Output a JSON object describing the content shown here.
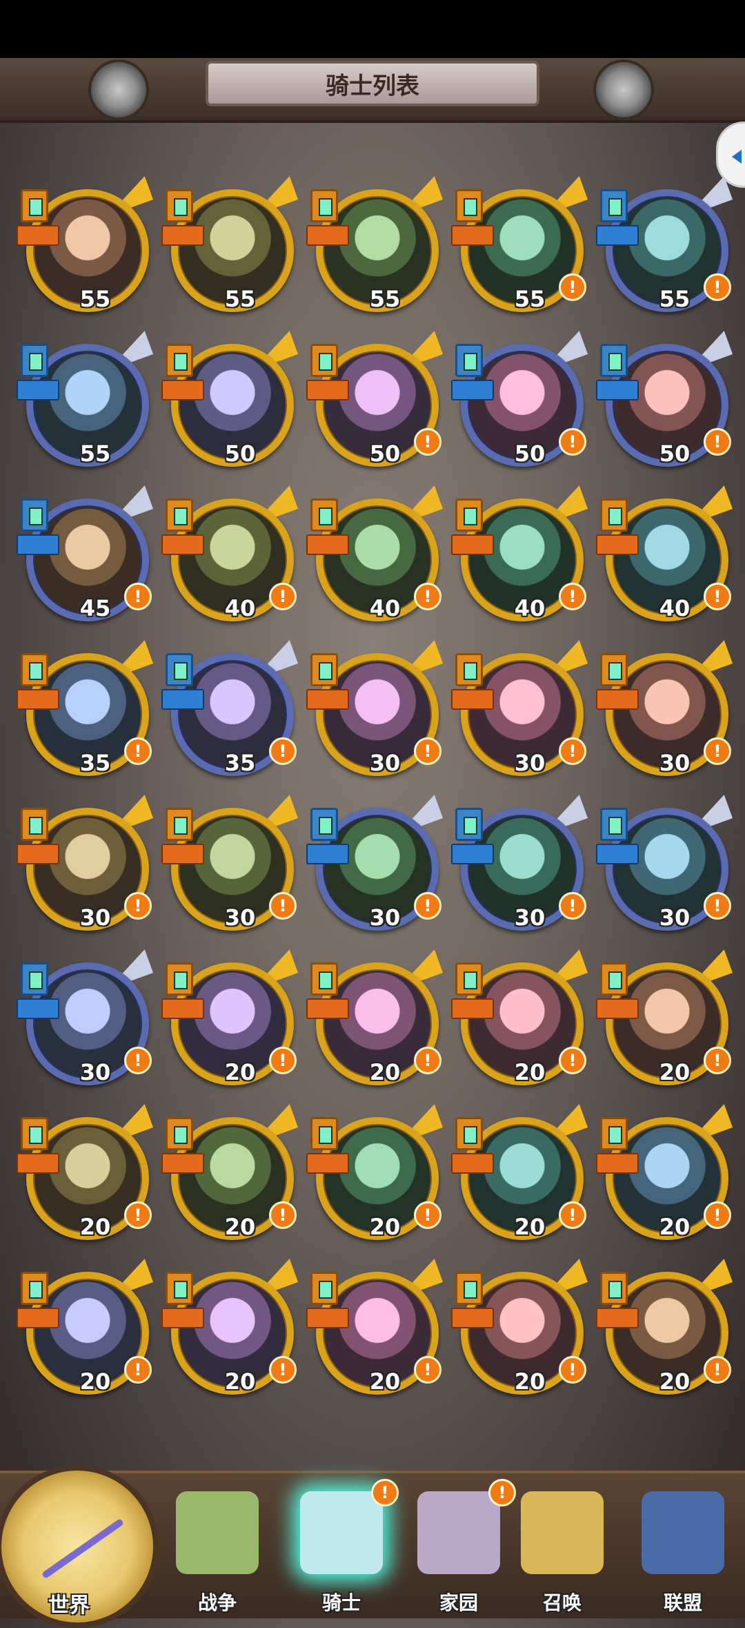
{
  "header": {
    "title": "骑士列表"
  },
  "colors": {
    "gold_ring": "#d9a31c",
    "blue_ring": "#5a6bb0",
    "alert": "#f07a14",
    "active_glow": "#52ffe8"
  },
  "knights": [
    {
      "level": "55",
      "frame": "gold",
      "alert": false
    },
    {
      "level": "55",
      "frame": "gold",
      "alert": false
    },
    {
      "level": "55",
      "frame": "gold",
      "alert": false
    },
    {
      "level": "55",
      "frame": "gold",
      "alert": true
    },
    {
      "level": "55",
      "frame": "blue",
      "alert": true
    },
    {
      "level": "55",
      "frame": "blue",
      "alert": false
    },
    {
      "level": "50",
      "frame": "gold",
      "alert": false
    },
    {
      "level": "50",
      "frame": "gold",
      "alert": true
    },
    {
      "level": "50",
      "frame": "blue",
      "alert": true
    },
    {
      "level": "50",
      "frame": "blue",
      "alert": true
    },
    {
      "level": "45",
      "frame": "blue",
      "alert": true
    },
    {
      "level": "40",
      "frame": "gold",
      "alert": true
    },
    {
      "level": "40",
      "frame": "gold",
      "alert": true
    },
    {
      "level": "40",
      "frame": "gold",
      "alert": true
    },
    {
      "level": "40",
      "frame": "gold",
      "alert": true
    },
    {
      "level": "35",
      "frame": "gold",
      "alert": true
    },
    {
      "level": "35",
      "frame": "blue",
      "alert": true
    },
    {
      "level": "30",
      "frame": "gold",
      "alert": true
    },
    {
      "level": "30",
      "frame": "gold",
      "alert": true
    },
    {
      "level": "30",
      "frame": "gold",
      "alert": true
    },
    {
      "level": "30",
      "frame": "gold",
      "alert": true
    },
    {
      "level": "30",
      "frame": "gold",
      "alert": true
    },
    {
      "level": "30",
      "frame": "blue",
      "alert": true
    },
    {
      "level": "30",
      "frame": "blue",
      "alert": true
    },
    {
      "level": "30",
      "frame": "blue",
      "alert": true
    },
    {
      "level": "30",
      "frame": "blue",
      "alert": true
    },
    {
      "level": "20",
      "frame": "gold",
      "alert": true
    },
    {
      "level": "20",
      "frame": "gold",
      "alert": true
    },
    {
      "level": "20",
      "frame": "gold",
      "alert": true
    },
    {
      "level": "20",
      "frame": "gold",
      "alert": true
    },
    {
      "level": "20",
      "frame": "gold",
      "alert": true
    },
    {
      "level": "20",
      "frame": "gold",
      "alert": true
    },
    {
      "level": "20",
      "frame": "gold",
      "alert": true
    },
    {
      "level": "20",
      "frame": "gold",
      "alert": true
    },
    {
      "level": "20",
      "frame": "gold",
      "alert": true
    },
    {
      "level": "20",
      "frame": "gold",
      "alert": true
    },
    {
      "level": "20",
      "frame": "gold",
      "alert": true
    },
    {
      "level": "20",
      "frame": "gold",
      "alert": true
    },
    {
      "level": "20",
      "frame": "gold",
      "alert": true
    },
    {
      "level": "20",
      "frame": "gold",
      "alert": true
    }
  ],
  "nav": [
    {
      "label": "世界",
      "icon": "compass-icon",
      "active": false,
      "alert": false
    },
    {
      "label": "战争",
      "icon": "map-icon",
      "active": false,
      "alert": false
    },
    {
      "label": "骑士",
      "icon": "knight-icon",
      "active": true,
      "alert": true
    },
    {
      "label": "家园",
      "icon": "gear-house-icon",
      "active": false,
      "alert": true
    },
    {
      "label": "召唤",
      "icon": "summon-icon",
      "active": false,
      "alert": false
    },
    {
      "label": "联盟",
      "icon": "shield-icon",
      "active": false,
      "alert": false
    }
  ]
}
